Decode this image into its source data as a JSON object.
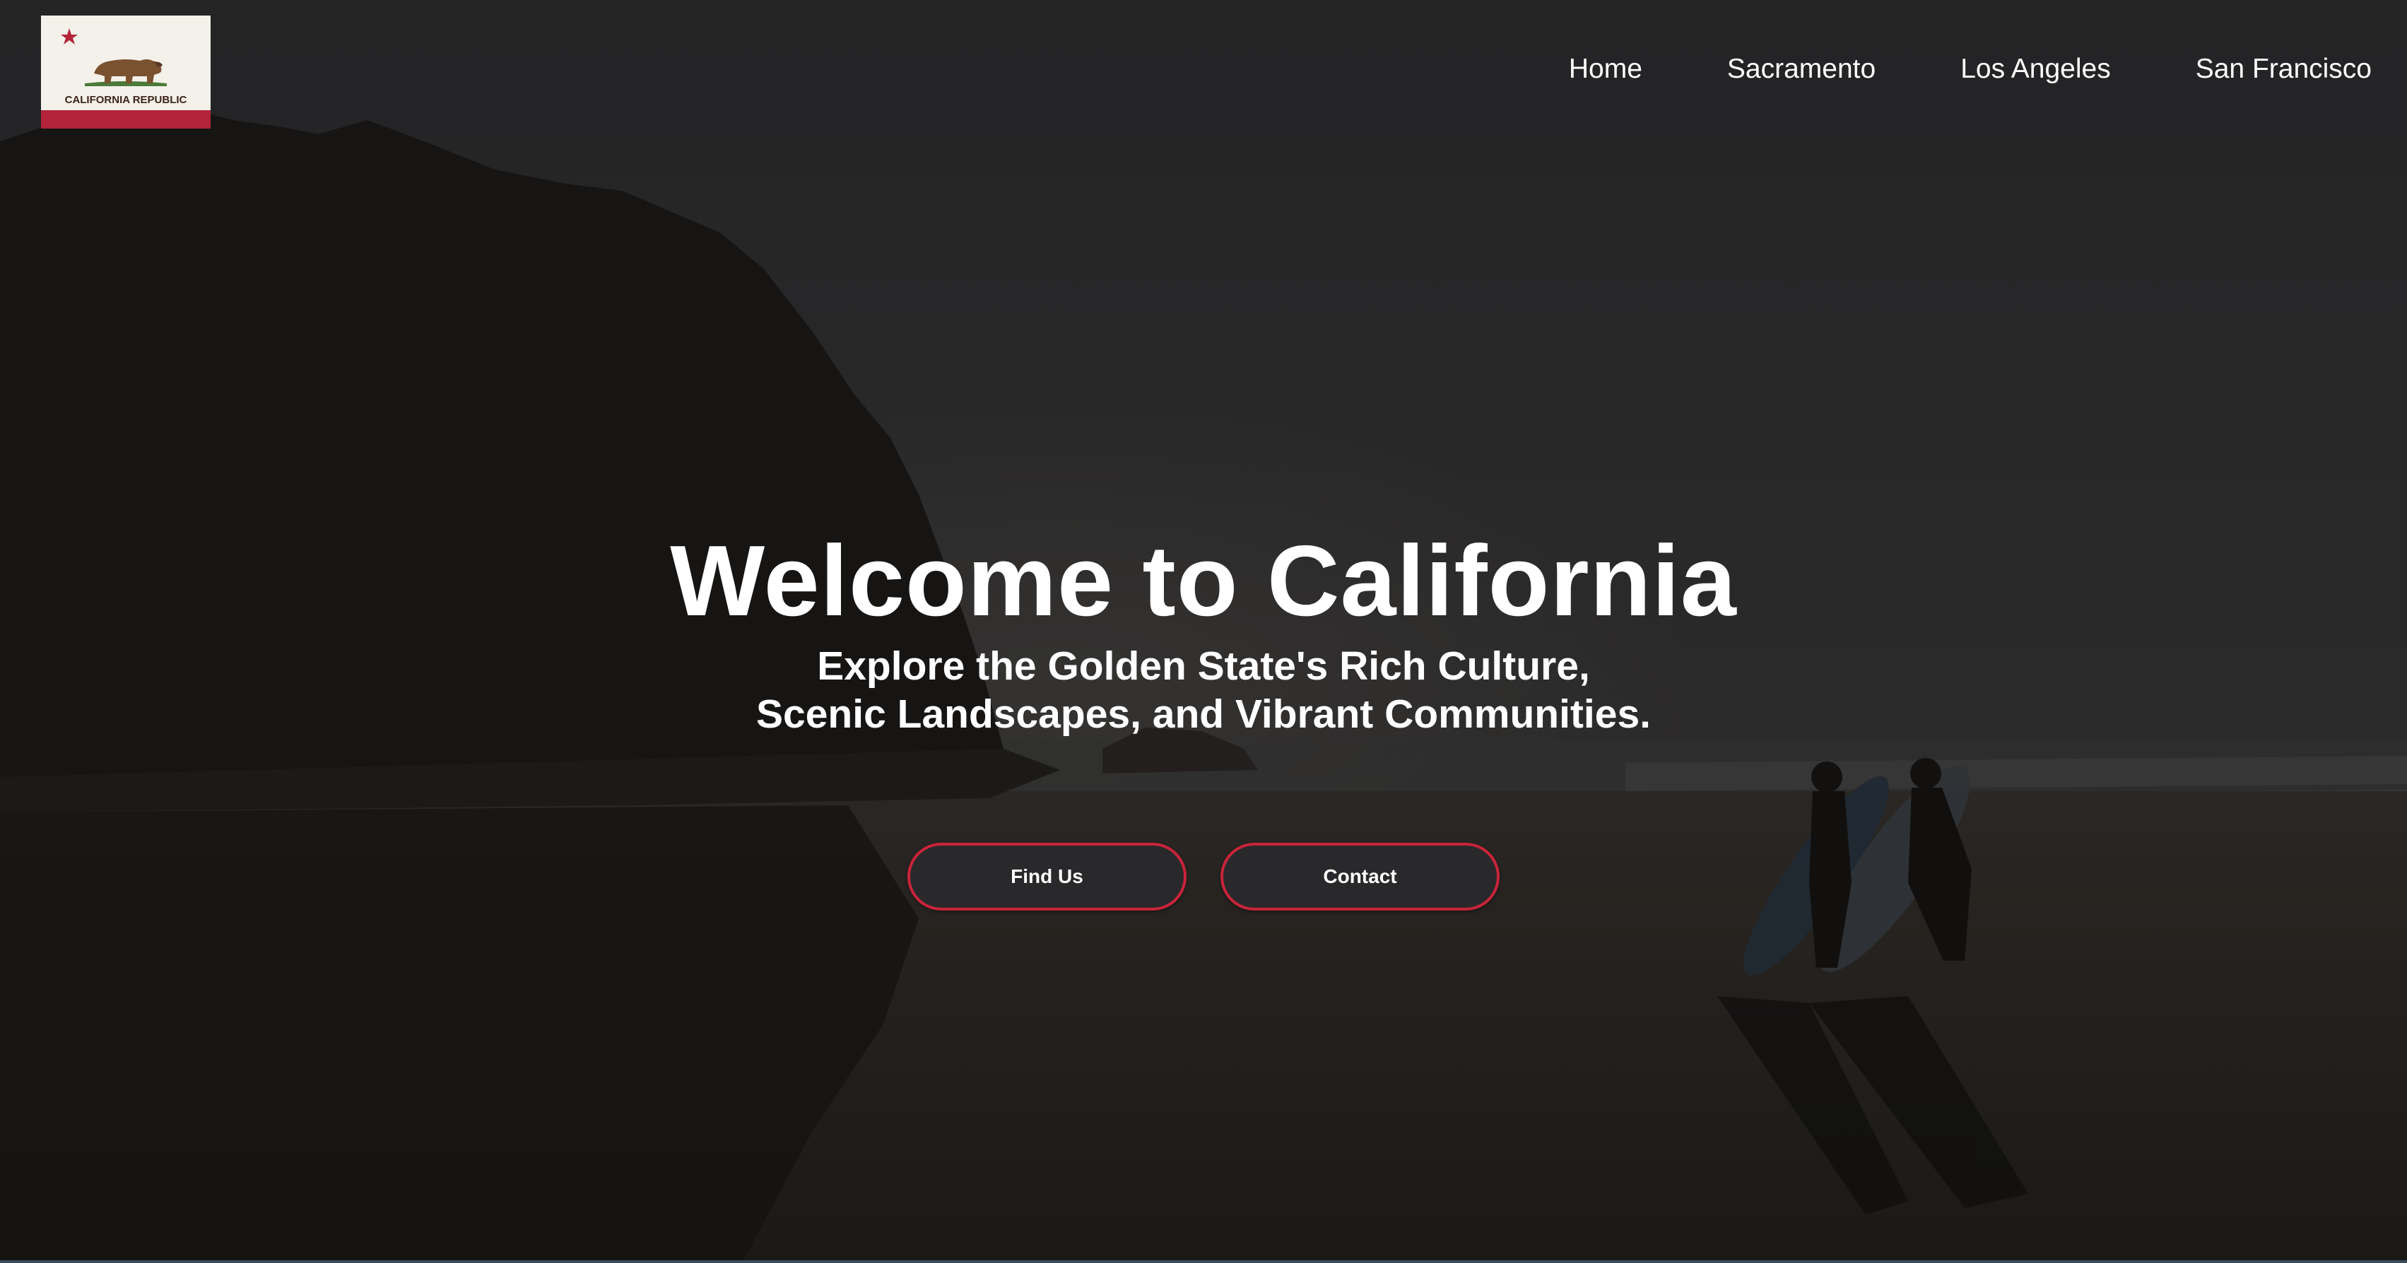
{
  "logo": {
    "label": "CALIFORNIA REPUBLIC"
  },
  "nav": {
    "items": [
      {
        "label": "Home"
      },
      {
        "label": "Sacramento"
      },
      {
        "label": "Los Angeles"
      },
      {
        "label": "San Francisco"
      }
    ]
  },
  "hero": {
    "title": "Welcome to California",
    "subtitle_line1": "Explore the Golden State's Rich Culture,",
    "subtitle_line2": "Scenic Landscapes, and Vibrant Communities."
  },
  "cta": {
    "find_us_label": "Find Us",
    "contact_label": "Contact"
  },
  "colors": {
    "accent": "#c8243a",
    "button_bg": "#29292b",
    "text": "#ffffff",
    "overlay": "#2a2a2c"
  }
}
